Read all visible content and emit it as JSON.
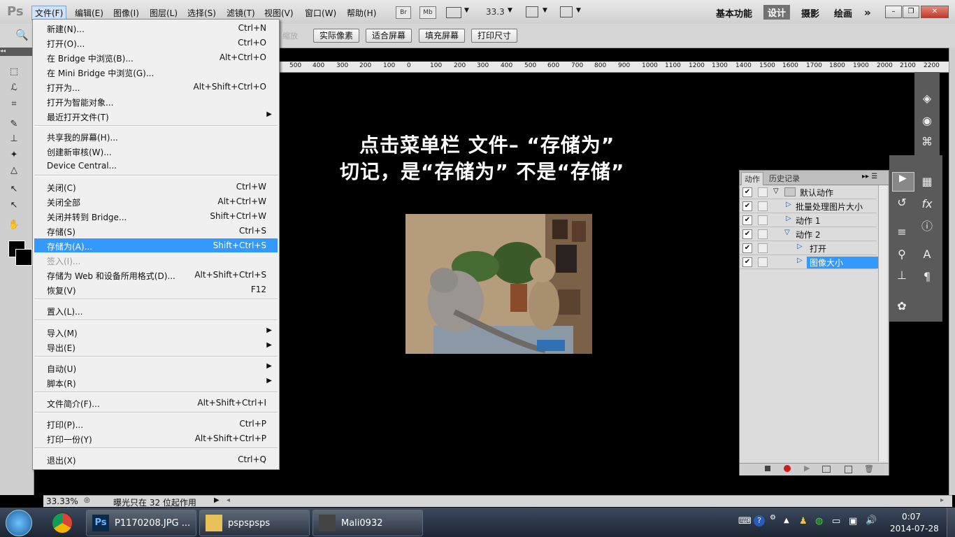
{
  "app": {
    "logo": "Ps",
    "menus": [
      "文件(F)",
      "编辑(E)",
      "图像(I)",
      "图层(L)",
      "选择(S)",
      "滤镜(T)",
      "视图(V)",
      "窗口(W)",
      "帮助(H)"
    ],
    "bridge_btn": "Br",
    "minibridge_btn": "Mb",
    "zoom_value": "33.3",
    "workspaces": [
      "基本功能",
      "设计",
      "摄影",
      "绘画"
    ],
    "workspace_selected": "设计",
    "more": "»"
  },
  "options_bar": {
    "buttons": [
      "实际像素",
      "适合屏幕",
      "填充屏幕",
      "打印尺寸"
    ],
    "faded_label": "缩放"
  },
  "ruler": {
    "ticks": [
      "500",
      "400",
      "300",
      "200",
      "100",
      "0",
      "100",
      "200",
      "300",
      "400",
      "500",
      "600",
      "700",
      "800",
      "900",
      "1000",
      "1100",
      "1200",
      "1300",
      "1400",
      "1500",
      "1600",
      "1700",
      "1800",
      "1900",
      "2000",
      "2100",
      "2200"
    ]
  },
  "canvas": {
    "line1": "点击菜单栏  文件–  “存储为”",
    "line2": "切记，是“存储为” 不是“存储”"
  },
  "file_menu": {
    "groups": [
      [
        {
          "label": "新建(N)...",
          "shortcut": "Ctrl+N"
        },
        {
          "label": "打开(O)...",
          "shortcut": "Ctrl+O"
        },
        {
          "label": "在 Bridge 中浏览(B)...",
          "shortcut": "Alt+Ctrl+O"
        },
        {
          "label": "在 Mini Bridge 中浏览(G)...",
          "shortcut": ""
        },
        {
          "label": "打开为...",
          "shortcut": "Alt+Shift+Ctrl+O"
        },
        {
          "label": "打开为智能对象...",
          "shortcut": ""
        },
        {
          "label": "最近打开文件(T)",
          "shortcut": "",
          "submenu": true
        }
      ],
      [
        {
          "label": "共享我的屏幕(H)...",
          "shortcut": ""
        },
        {
          "label": "创建新审核(W)...",
          "shortcut": ""
        },
        {
          "label": "Device Central...",
          "shortcut": ""
        }
      ],
      [
        {
          "label": "关闭(C)",
          "shortcut": "Ctrl+W"
        },
        {
          "label": "关闭全部",
          "shortcut": "Alt+Ctrl+W"
        },
        {
          "label": "关闭并转到 Bridge...",
          "shortcut": "Shift+Ctrl+W"
        },
        {
          "label": "存储(S)",
          "shortcut": "Ctrl+S"
        },
        {
          "label": "存储为(A)...",
          "shortcut": "Shift+Ctrl+S",
          "highlighted": true
        },
        {
          "label": "签入(I)...",
          "shortcut": "",
          "disabled": true
        },
        {
          "label": "存储为 Web 和设备所用格式(D)...",
          "shortcut": "Alt+Shift+Ctrl+S"
        },
        {
          "label": "恢复(V)",
          "shortcut": "F12"
        }
      ],
      [
        {
          "label": "置入(L)...",
          "shortcut": ""
        }
      ],
      [
        {
          "label": "导入(M)",
          "shortcut": "",
          "submenu": true
        },
        {
          "label": "导出(E)",
          "shortcut": "",
          "submenu": true
        }
      ],
      [
        {
          "label": "自动(U)",
          "shortcut": "",
          "submenu": true
        },
        {
          "label": "脚本(R)",
          "shortcut": "",
          "submenu": true
        }
      ],
      [
        {
          "label": "文件简介(F)...",
          "shortcut": "Alt+Shift+Ctrl+I"
        }
      ],
      [
        {
          "label": "打印(P)...",
          "shortcut": "Ctrl+P"
        },
        {
          "label": "打印一份(Y)",
          "shortcut": "Alt+Shift+Ctrl+P"
        }
      ],
      [
        {
          "label": "退出(X)",
          "shortcut": "Ctrl+Q"
        }
      ]
    ]
  },
  "actions_panel": {
    "tabs": [
      "动作",
      "历史记录"
    ],
    "active_tab": "动作",
    "rows": [
      {
        "label": "默认动作",
        "indent": 0,
        "type": "folder"
      },
      {
        "label": "批量处理图片大小",
        "indent": 1,
        "type": "action"
      },
      {
        "label": "动作 1",
        "indent": 1,
        "type": "action"
      },
      {
        "label": "动作 2",
        "indent": 1,
        "type": "action-open"
      },
      {
        "label": "打开",
        "indent": 2,
        "type": "step"
      },
      {
        "label": "图像大小",
        "indent": 2,
        "type": "step",
        "selected": true
      }
    ]
  },
  "status_bar": {
    "zoom": "33.33%",
    "info": "曝光只在 32 位起作用"
  },
  "taskbar": {
    "items": [
      {
        "label": "P1170208.JPG ...",
        "icon": "photoshop-icon"
      },
      {
        "label": "pspspsps",
        "icon": "folder-icon"
      },
      {
        "label": "Mali0932",
        "icon": "thumbnail-icon"
      }
    ],
    "time": "0:07",
    "date": "2014-07-28"
  }
}
